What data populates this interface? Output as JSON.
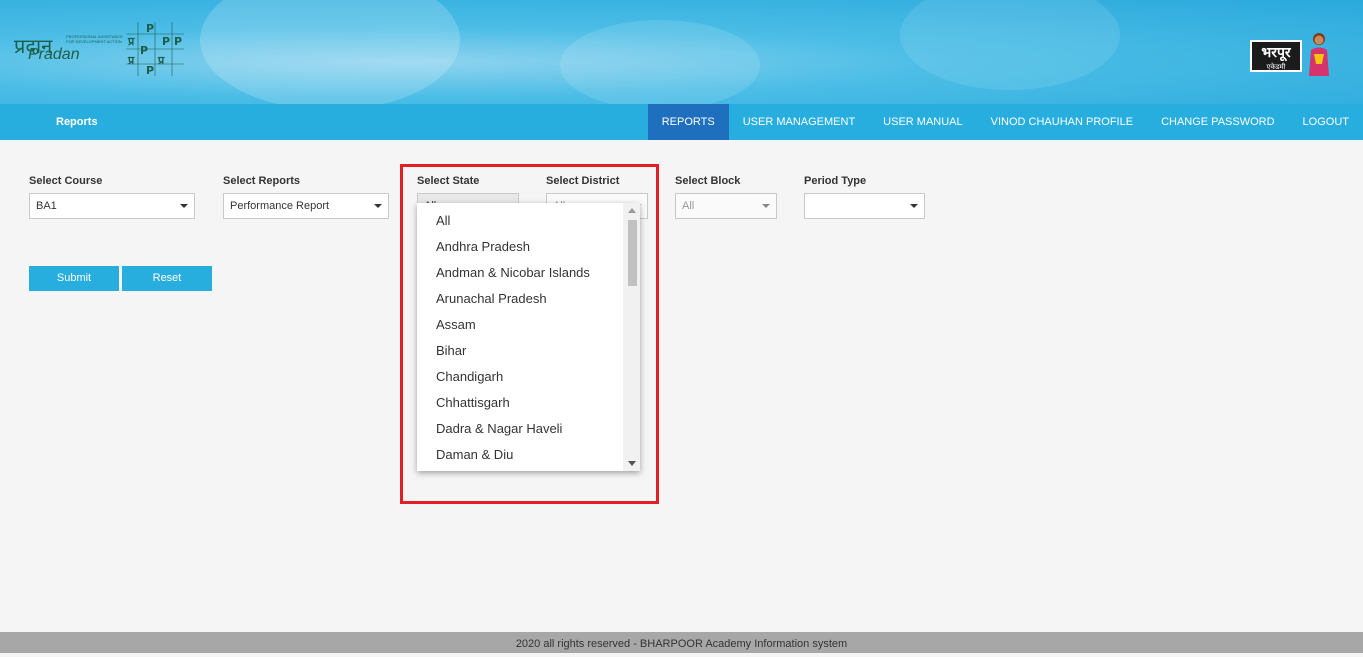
{
  "header": {
    "logo_pradan_hindi": "प्रदान",
    "logo_pradan_english": "Pradan",
    "logo_pradan_tagline": "PROFESSIONAL ASSISTANCE FOR DEVELOPMENT ACTION",
    "logo_bharpoor_hindi": "भरपूर",
    "logo_bharpoor_sub": "एकेडमी"
  },
  "nav": {
    "brand": "Reports",
    "items": [
      {
        "label": "REPORTS",
        "active": true
      },
      {
        "label": "USER MANAGEMENT",
        "active": false
      },
      {
        "label": "USER MANUAL",
        "active": false
      },
      {
        "label": "VINOD CHAUHAN PROFILE",
        "active": false
      },
      {
        "label": "CHANGE PASSWORD",
        "active": false
      },
      {
        "label": "LOGOUT",
        "active": false
      }
    ]
  },
  "form": {
    "course": {
      "label": "Select Course",
      "value": "BA1"
    },
    "reports": {
      "label": "Select Reports",
      "value": "Performance Report"
    },
    "state": {
      "label": "Select State",
      "value": "All"
    },
    "district": {
      "label": "Select District",
      "value": "All"
    },
    "block": {
      "label": "Select Block",
      "value": "All"
    },
    "period": {
      "label": "Period Type",
      "value": ""
    },
    "submit_label": "Submit",
    "reset_label": "Reset"
  },
  "state_dropdown": {
    "options": [
      "All",
      "Andhra Pradesh",
      "Andman & Nicobar Islands",
      "Arunachal Pradesh",
      "Assam",
      "Bihar",
      "Chandigarh",
      "Chhattisgarh",
      "Dadra & Nagar Haveli",
      "Daman & Diu"
    ]
  },
  "colors": {
    "nav_bg": "#27aede",
    "nav_active": "#1f6fbf",
    "highlight": "#e21f26"
  },
  "footer": {
    "text": "2020 all rights reserved - BHARPOOR Academy Information system"
  }
}
